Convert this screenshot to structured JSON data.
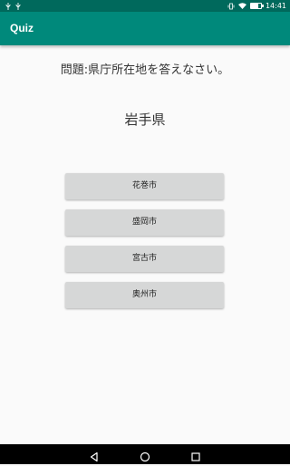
{
  "status_bar": {
    "left_icons": [
      "usb-icon",
      "usb-icon"
    ],
    "right_icons": [
      "vibrate-icon",
      "wifi-icon",
      "battery-icon"
    ],
    "time": "14:41",
    "battery_level": 0.7
  },
  "app_bar": {
    "title": "Quiz"
  },
  "quiz": {
    "question": "問題:県庁所在地を答えなさい。",
    "prefecture": "岩手県",
    "choices": [
      "花巻市",
      "盛岡市",
      "宮古市",
      "奥州市"
    ]
  },
  "nav_bar": {
    "icons": [
      "back-icon",
      "home-icon",
      "recents-icon"
    ]
  },
  "colors": {
    "status_bar": "#00695c",
    "app_bar": "#00897b",
    "background": "#fafafa",
    "button": "#d6d7d7"
  }
}
